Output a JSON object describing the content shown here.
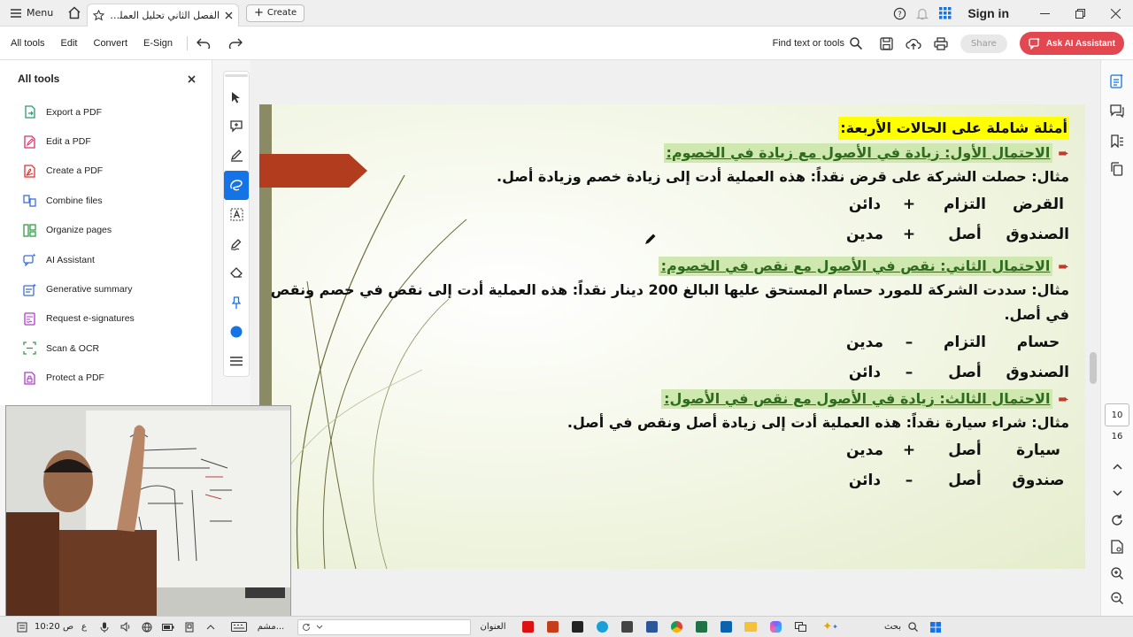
{
  "titlebar": {
    "menu_label": "Menu",
    "tab_title": "الفصل الثاني تحليل العمليات ا...",
    "create_label": "Create",
    "signin_label": "Sign in"
  },
  "toolbar": {
    "items": [
      "All tools",
      "Edit",
      "Convert",
      "E-Sign"
    ],
    "find_label": "Find text or tools",
    "share_label": "Share",
    "ai_label": "Ask AI Assistant"
  },
  "left_panel": {
    "title": "All tools",
    "tools": [
      {
        "label": "Export a PDF",
        "icon": "export-pdf-icon",
        "color": "#2b9a6b"
      },
      {
        "label": "Edit a PDF",
        "icon": "edit-pdf-icon",
        "color": "#d6336c"
      },
      {
        "label": "Create a PDF",
        "icon": "create-pdf-icon",
        "color": "#e03131"
      },
      {
        "label": "Combine files",
        "icon": "combine-files-icon",
        "color": "#3b6fd8"
      },
      {
        "label": "Organize pages",
        "icon": "organize-pages-icon",
        "color": "#2f9e44"
      },
      {
        "label": "AI Assistant",
        "icon": "ai-assistant-icon",
        "color": "#3b6fd8"
      },
      {
        "label": "Generative summary",
        "icon": "generative-summary-icon",
        "color": "#3b6fd8"
      },
      {
        "label": "Request e-signatures",
        "icon": "request-esign-icon",
        "color": "#ae3ec9"
      },
      {
        "label": "Scan & OCR",
        "icon": "scan-ocr-icon",
        "color": "#2f9e44"
      },
      {
        "label": "Protect a PDF",
        "icon": "protect-pdf-icon",
        "color": "#ae3ec9"
      }
    ]
  },
  "slide": {
    "title": "أمثلة شاملة على الحالات الأربعة:",
    "case1": {
      "heading": "الاحتمال الأول: زيادة في الأصول مع زيادة في الخصوم:",
      "example": "مثال: حصلت الشركة على قرض نقداً: هذه العملية أدت إلى زيادة خصم وزيادة أصل.",
      "row1": [
        "القرض",
        "التزام",
        "+",
        "دائن"
      ],
      "row2": [
        "الصندوق",
        "أصل",
        "+",
        "مدين"
      ]
    },
    "case2": {
      "heading": "الاحتمال الثاني: نقص في الأصول مع نقص في الخصوم:",
      "example_line1": "مثال: سددت الشركة للمورد حسام المستحق عليها البالغ 200 دينار نقداً: هذه العملية أدت إلى نقص في خصم ونقص",
      "example_line2": "في أصل.",
      "row1": [
        "حسام",
        "التزام",
        "–",
        "مدين"
      ],
      "row2": [
        "الصندوق",
        "أصل",
        "–",
        "دائن"
      ]
    },
    "case3": {
      "heading": "الاحتمال الثالث: زيادة في الأصول مع نقص في الأصول:",
      "example": "مثال: شراء سيارة نقداً: هذه العملية أدت إلى زيادة أصل ونقص في أصل.",
      "row1": [
        "سيارة",
        "أصل",
        "+",
        "مدين"
      ],
      "row2": [
        "صندوق",
        "أصل",
        "–",
        "دائن"
      ]
    }
  },
  "page_nav": {
    "current": "10",
    "total": "16"
  },
  "taskbar": {
    "time": "10:20 ص",
    "lang": "ع",
    "address_label": "العنوان",
    "search_label": "بحث",
    "app_label": "مشم..."
  }
}
